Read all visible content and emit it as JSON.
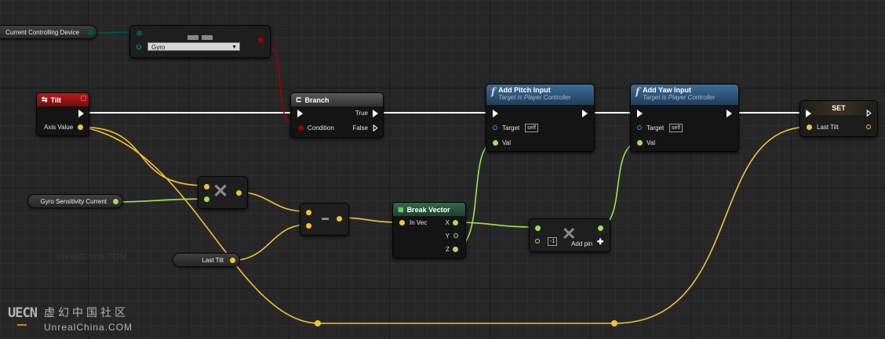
{
  "variables": {
    "current_controlling_device": "Current Controlling Device",
    "gyro_sensitivity_current": "Gyro Sensitivity Current",
    "last_tilt": "Last Tilt"
  },
  "tilt_event": {
    "title": "Tilt",
    "axis_value": "Axis Value"
  },
  "compare_node": {
    "dropdown_value": "Gyro"
  },
  "branch": {
    "title": "Branch",
    "true_label": "True",
    "false_label": "False",
    "condition_label": "Condition"
  },
  "add_pitch": {
    "title": "Add Pitch Input",
    "subtitle": "Target is Player Controller",
    "target": "Target",
    "self": "self",
    "val": "Val"
  },
  "add_yaw": {
    "title": "Add Yaw Input",
    "subtitle": "Target is Player Controller",
    "target": "Target",
    "self": "self",
    "val": "Val"
  },
  "set_node": {
    "title": "SET",
    "last_tilt": "Last Tilt"
  },
  "break_vector": {
    "title": "Break Vector",
    "in_vec": "In Vec",
    "x": "X",
    "y": "Y",
    "z": "Z"
  },
  "multiply_node": {
    "value": "-1",
    "add_pin": "Add pin"
  },
  "watermark": {
    "logo": "UECN",
    "cn_text": "虚幻中国社区",
    "site": "UnrealChina.COM",
    "faint": "UnrealChina.COM"
  },
  "colors": {
    "exec": "#ffffff",
    "float": "#f4c231",
    "vector": "#f0c93a",
    "bool": "#a00000",
    "enum": "#01594a",
    "object": "#00a8f2",
    "graph_bg": "#262626"
  }
}
